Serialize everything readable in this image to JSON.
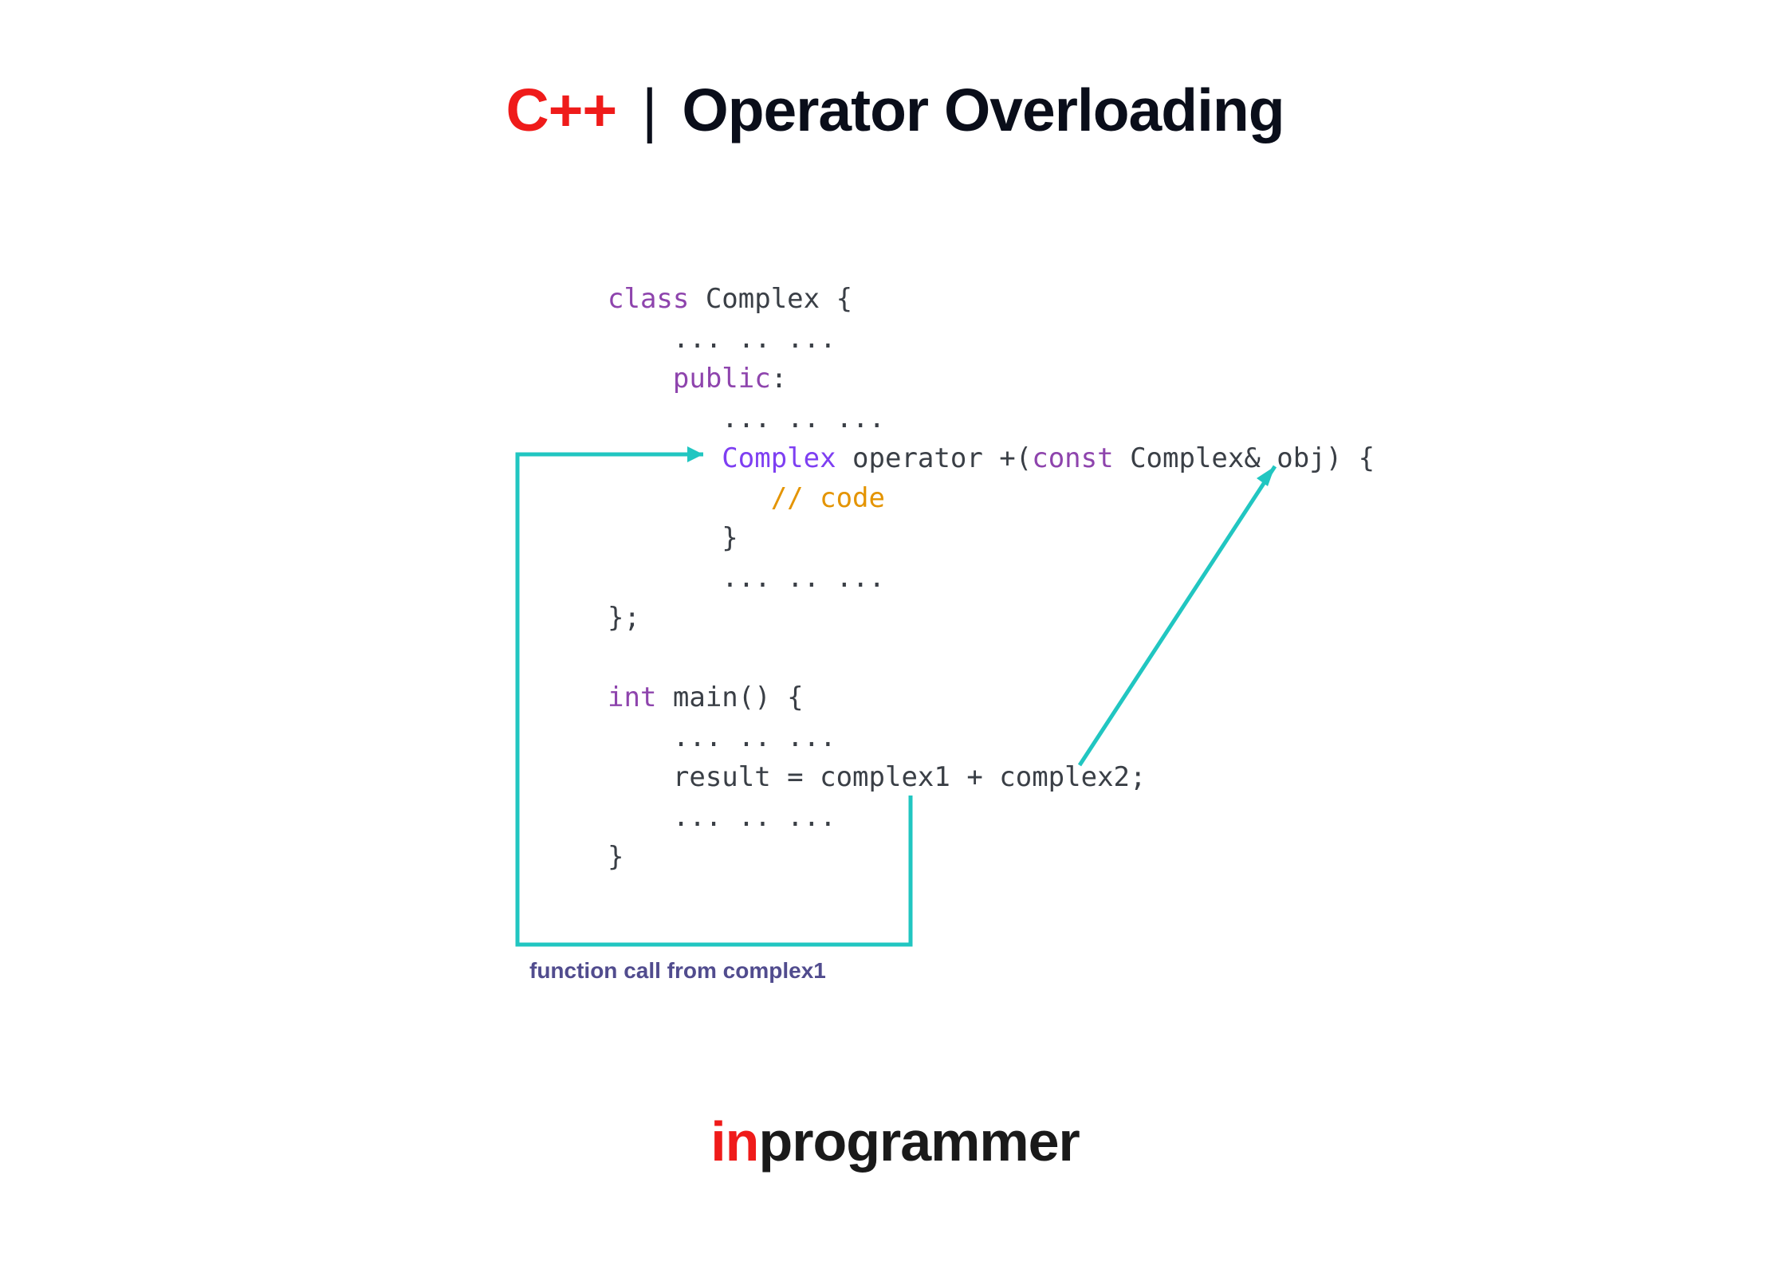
{
  "header": {
    "cpp": "C++",
    "separator": "|",
    "subject": "Operator Overloading"
  },
  "code": {
    "l1a": "class",
    "l1b": " Complex {",
    "l2": "    ... .. ...",
    "l3a": "    public",
    "l3b": ":",
    "l4": "       ... .. ...",
    "l5a": "       Complex ",
    "l5b": "operator",
    "l5c": " +(",
    "l5d": "const",
    "l5e": " Complex& obj) {",
    "l6": "          // code",
    "l7": "       }",
    "l8": "       ... .. ...",
    "l9": "};",
    "l10": "",
    "l11a": "int",
    "l11b": " main() {",
    "l12": "    ... .. ...",
    "l13": "    result = complex1 + complex2;",
    "l14": "    ... .. ...",
    "l15": "}"
  },
  "caption": "function call from complex1",
  "footer": {
    "in": "in",
    "rest": "programmer"
  },
  "colors": {
    "teal": "#21c6c1",
    "red": "#ef1b1a",
    "purple": "#8e44ad",
    "orange": "#e49400"
  }
}
